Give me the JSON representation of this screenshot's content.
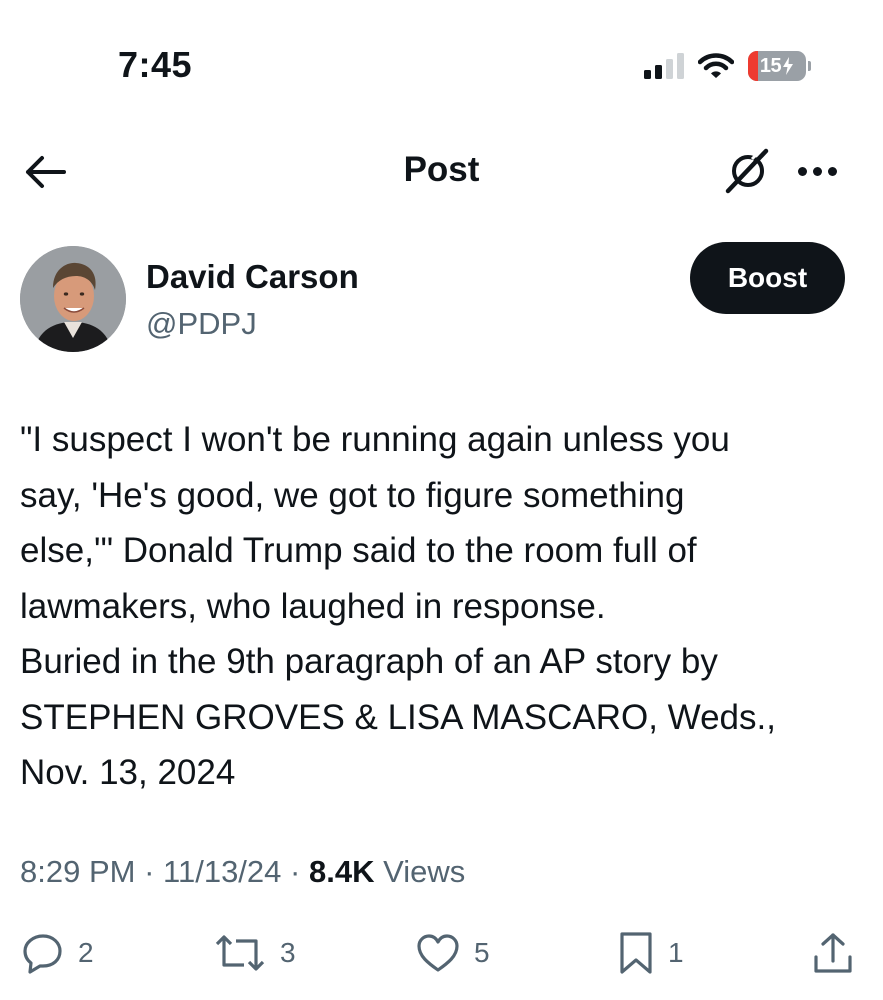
{
  "status_bar": {
    "time": "7:45",
    "battery_level": "15",
    "icons": [
      "cellular-signal-icon",
      "wifi-icon",
      "battery-charging-icon"
    ]
  },
  "header": {
    "title": "Post",
    "icons": [
      "back-arrow-icon",
      "grok-icon",
      "more-icon"
    ]
  },
  "author": {
    "name": "David Carson",
    "handle": "@PDPJ",
    "boost_label": "Boost"
  },
  "post": {
    "lines": [
      "\"I suspect I won't be running again unless you",
      "say, 'He's good, we got to figure something",
      "else,'\" Donald Trump said to the room full of",
      "lawmakers, who laughed in response.",
      "Buried in the 9th paragraph of an AP story by",
      "STEPHEN GROVES & LISA MASCARO, Weds.,",
      "Nov. 13, 2024"
    ]
  },
  "meta": {
    "time": "8:29 PM",
    "separator": "·",
    "date": "11/13/24",
    "views_count": "8.4K",
    "views_label": "Views"
  },
  "actions": {
    "replies": "2",
    "reposts": "3",
    "likes": "5",
    "bookmarks": "1"
  },
  "colors": {
    "text": "#0f1419",
    "secondary": "#536471",
    "button_bg": "#0f1419",
    "battery_low": "#ee3b30"
  }
}
